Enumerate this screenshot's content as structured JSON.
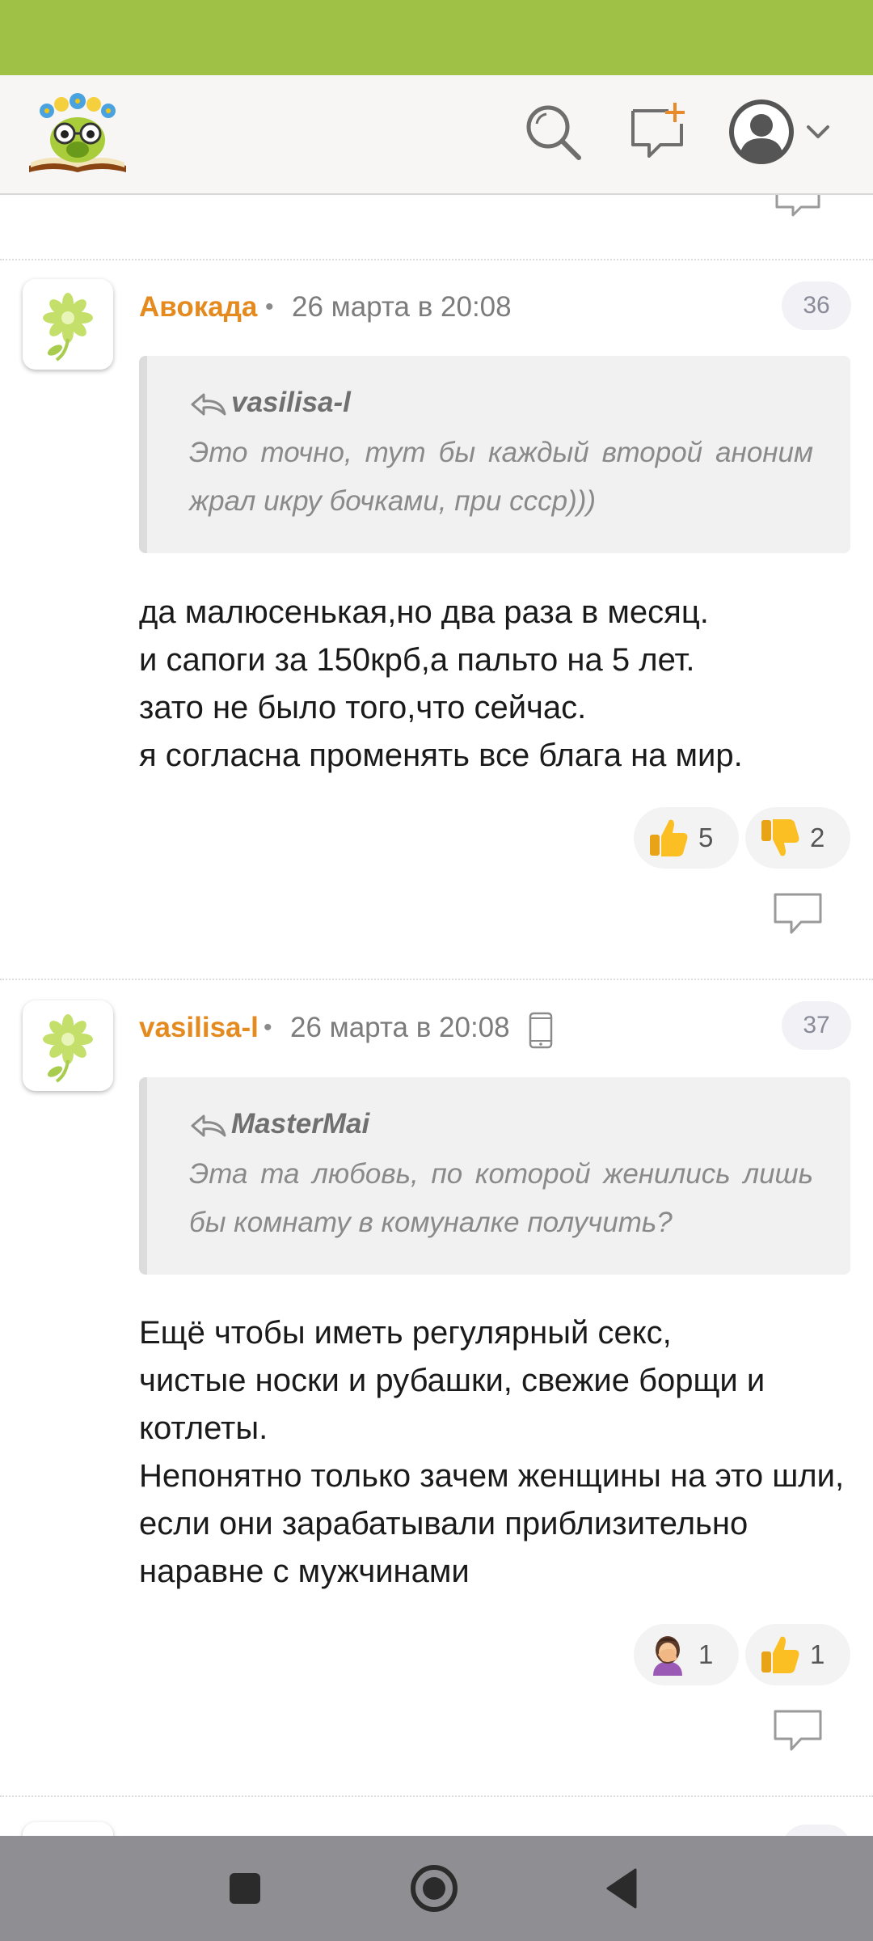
{
  "comments": [
    {
      "author": "Авокада",
      "separator": "•",
      "date": "26 марта в 20:08",
      "number": "36",
      "quote_author": "vasilisa-l",
      "quote_text": "Это точно, тут бы каждый второй аноним жрал икру бочками, при ссср)))",
      "text": "да малюсенькая,но два раза в месяц.\nи сапоги за 150крб,а пальто на 5 лет.\nзато не было того,что сейчас.\nя согласна променять все блага на мир.",
      "reactions": [
        {
          "icon": "thumbs-up-emoji",
          "count": "5"
        },
        {
          "icon": "thumbs-down-emoji",
          "count": "2"
        }
      ]
    },
    {
      "author": "vasilisa-l",
      "separator": "•",
      "date": "26 марта в 20:08",
      "number": "37",
      "device_icon": "mobile-phone-icon",
      "quote_author": "MasterMai",
      "quote_text": "Эта та любовь, по которой женились лишь бы комнату в комуналке получить?",
      "text": "Ещё чтобы иметь регулярный секс,\nчистые носки и рубашки, свежие борщи и котлеты.\nНепонятно только зачем женщины на это шли, если они зарабатывали приблизительно наравне с мужчинами",
      "reactions": [
        {
          "icon": "facepalm-woman-emoji",
          "count": "1"
        },
        {
          "icon": "thumbs-up-emoji",
          "count": "1"
        }
      ]
    }
  ],
  "colors": {
    "status_bar": "#9fc146",
    "author": "#e58a1f",
    "nav_bar": "#8e8e93"
  },
  "icons": {
    "header": [
      "logo-owl-book",
      "search-icon",
      "new-topic-icon",
      "user-avatar-icon",
      "chevron-down-icon"
    ],
    "nav": [
      "recent-apps-icon",
      "home-icon",
      "back-icon"
    ]
  }
}
